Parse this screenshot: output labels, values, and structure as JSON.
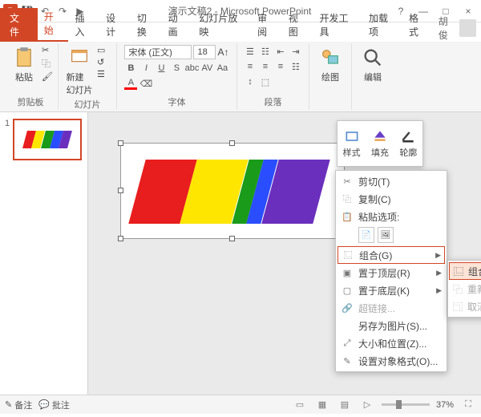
{
  "title": "演示文稿2 - Microsoft PowerPoint",
  "qat": {
    "logo": "P",
    "save": "💾",
    "undo": "↶",
    "redo": "↷",
    "start": "▶"
  },
  "wctrl": {
    "help": "?",
    "min": "—",
    "max": "□",
    "close": "×"
  },
  "tabs": {
    "file": "文件",
    "home": "开始",
    "insert": "插入",
    "design": "设计",
    "trans": "切换",
    "anim": "动画",
    "show": "幻灯片放映",
    "review": "审阅",
    "view": "视图",
    "dev": "开发工具",
    "addin": "加载项",
    "format": "格式"
  },
  "user": "胡俊",
  "ribbon": {
    "clipboard": {
      "paste": "粘贴",
      "label": "剪贴板"
    },
    "slides": {
      "new": "新建\n幻灯片",
      "label": "幻灯片"
    },
    "font": {
      "name": "宋体 (正文)",
      "size": "18",
      "label": "字体"
    },
    "para": {
      "label": "段落"
    },
    "draw": {
      "btn": "绘图",
      "label": ""
    },
    "edit": {
      "btn": "编辑",
      "label": ""
    }
  },
  "thumb": {
    "num": "1"
  },
  "minitoolbar": {
    "style": "样式",
    "fill": "填充",
    "outline": "轮廓"
  },
  "ctx": {
    "cut": "剪切(T)",
    "copy": "复制(C)",
    "pasteopt": "粘贴选项:",
    "group": "组合(G)",
    "front": "置于顶层(R)",
    "back": "置于底层(K)",
    "link": "超链接...",
    "savepic": "另存为图片(S)...",
    "sizepos": "大小和位置(Z)...",
    "fmt": "设置对象格式(O)..."
  },
  "sub": {
    "group": "组合(G)",
    "regroup": "重新组合(E)",
    "ungroup": "取消组合(U)"
  },
  "status": {
    "notes": "备注",
    "comments": "批注",
    "zoom": "37%"
  },
  "colors": {
    "red": "#e81e1e",
    "yellow": "#ffe600",
    "green": "#1a9b1a",
    "blue": "#2a4eff",
    "purple": "#6b2fbd"
  }
}
